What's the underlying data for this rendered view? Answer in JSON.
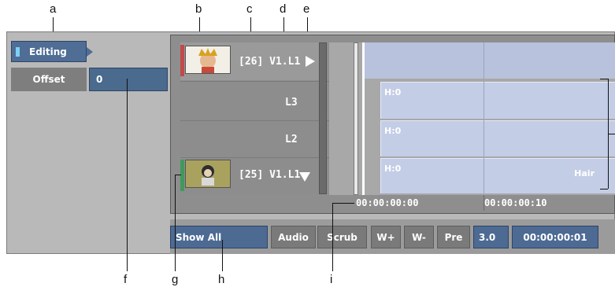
{
  "callouts": [
    "a",
    "b",
    "c",
    "d",
    "e",
    "f",
    "g",
    "h",
    "i"
  ],
  "editor": {
    "mode_button": "Editing",
    "offset_label": "Offset",
    "offset_value": "0"
  },
  "tracks": {
    "top_clip_label": "[26] V1.L1",
    "layer_3": "L3",
    "layer_2": "L2",
    "bottom_clip_label": "[25] V1.L1"
  },
  "segments": [
    {
      "label": "H:0",
      "right_label": ""
    },
    {
      "label": "H:0",
      "right_label": ""
    },
    {
      "label": "H:0",
      "right_label": "Hair"
    }
  ],
  "timecode": {
    "start": "00:00:00:00",
    "mark": "00:00:00:10"
  },
  "toolbar": {
    "show_all": "Show All",
    "audio": "Audio",
    "scrub": "Scrub",
    "w_plus": "W+",
    "w_minus": "W-",
    "pre": "Pre",
    "speed": "3.0",
    "current_time": "00:00:00:01"
  },
  "colors": {
    "panel_bg": "#b9b9b9",
    "button_blue": "#4f6d95",
    "segment": "#c4cde6",
    "marker_red": "#c24a4a",
    "marker_green": "#3f9a5a"
  }
}
